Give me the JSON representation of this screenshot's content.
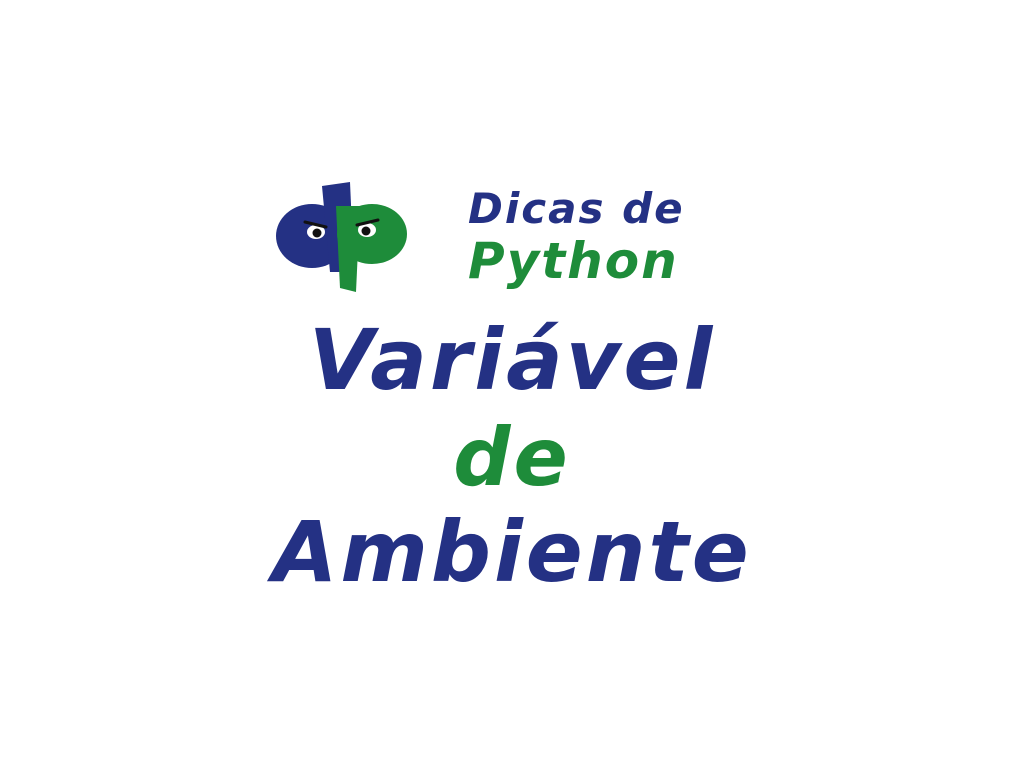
{
  "colors": {
    "background": "#ffffff",
    "brand_blue": "#243184",
    "brand_green": "#1e8c3a"
  },
  "logo": {
    "icon": "dp-monogram-logo",
    "monogram": "dp"
  },
  "brand": {
    "line1": "Dicas de",
    "line2": "Python"
  },
  "title": {
    "line1": "Variável",
    "line2": "de",
    "line3": "Ambiente"
  }
}
